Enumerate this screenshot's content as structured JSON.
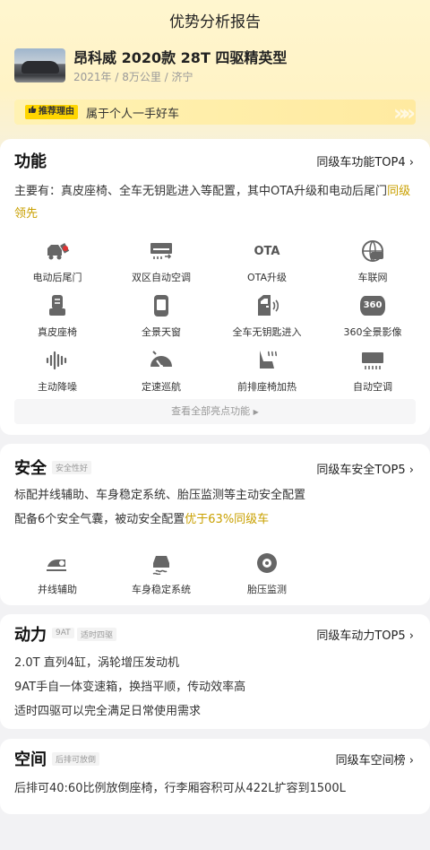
{
  "page_title": "优势分析报告",
  "car": {
    "name": "昂科威 2020款 28T 四驱精英型",
    "meta": "2021年 / 8万公里 / 济宁"
  },
  "reason": {
    "tag": "推荐理由",
    "text": "属于个人一手好车"
  },
  "function": {
    "title": "功能",
    "rank": "同级车功能TOP4",
    "summary_plain": "主要有：真皮座椅、全车无钥匙进入等配置，其中OTA升级和电动后尾门",
    "summary_hl": "同级领先",
    "items": [
      {
        "label": "电动后尾门",
        "icon": "tailgate-icon"
      },
      {
        "label": "双区自动空调",
        "icon": "ac-dual-icon"
      },
      {
        "label": "OTA升级",
        "icon": "ota-icon"
      },
      {
        "label": "车联网",
        "icon": "connected-car-icon"
      },
      {
        "label": "真皮座椅",
        "icon": "leather-seat-icon"
      },
      {
        "label": "全景天窗",
        "icon": "sunroof-icon"
      },
      {
        "label": "全车无钥匙进入",
        "icon": "keyless-entry-icon"
      },
      {
        "label": "360全景影像",
        "icon": "camera-360-icon"
      },
      {
        "label": "主动降噪",
        "icon": "noise-cancel-icon"
      },
      {
        "label": "定速巡航",
        "icon": "cruise-icon"
      },
      {
        "label": "前排座椅加热",
        "icon": "seat-heat-icon"
      },
      {
        "label": "自动空调",
        "icon": "auto-ac-icon"
      }
    ],
    "ota_text": "OTA",
    "cam_text": "360",
    "more": "查看全部亮点功能"
  },
  "safety": {
    "title": "安全",
    "chip": "安全性好",
    "rank": "同级车安全TOP5",
    "line1": "标配并线辅助、车身稳定系统、胎压监测等主动安全配置",
    "line2_plain": "配备6个安全气囊，被动安全配置",
    "line2_hl": "优于63%同级车",
    "items": [
      {
        "label": "并线辅助",
        "icon": "lane-assist-icon"
      },
      {
        "label": "车身稳定系统",
        "icon": "stability-icon"
      },
      {
        "label": "胎压监测",
        "icon": "tire-pressure-icon"
      }
    ]
  },
  "power": {
    "title": "动力",
    "chip1": "9AT",
    "chip2": "适时四驱",
    "rank": "同级车动力TOP5",
    "lines": [
      "2.0T 直列4缸，涡轮增压发动机",
      "9AT手自一体变速箱，换挡平顺，传动效率高",
      "适时四驱可以完全满足日常使用需求"
    ]
  },
  "space": {
    "title": "空间",
    "chip": "后排可放倒",
    "rank": "同级车空间榜",
    "line": "后排可40:60比例放倒座椅，行李厢容积可从422L扩容到1500L"
  },
  "colors": {
    "accent": "#ffd600",
    "highlight": "#c9a000"
  }
}
